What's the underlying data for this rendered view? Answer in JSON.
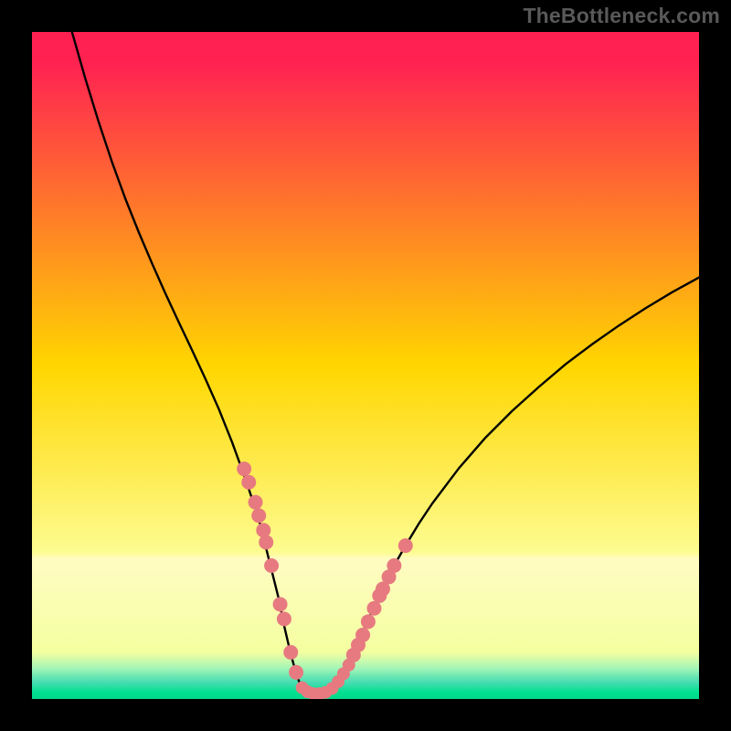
{
  "watermark": "TheBottleneck.com",
  "chart_data": {
    "type": "line",
    "title": "",
    "xlabel": "",
    "ylabel": "",
    "xlim": [
      0,
      100
    ],
    "ylim": [
      0,
      100
    ],
    "gradient_stops": [
      {
        "offset": 0.0,
        "color": "#ff2052"
      },
      {
        "offset": 0.05,
        "color": "#ff2351"
      },
      {
        "offset": 0.5,
        "color": "#ffd600"
      },
      {
        "offset": 0.78,
        "color": "#fdfc90"
      },
      {
        "offset": 0.79,
        "color": "#fffcc2"
      },
      {
        "offset": 0.93,
        "color": "#f4ffa0"
      },
      {
        "offset": 0.955,
        "color": "#a0f5b8"
      },
      {
        "offset": 0.965,
        "color": "#6fe8b3"
      },
      {
        "offset": 0.975,
        "color": "#48dcb2"
      },
      {
        "offset": 0.99,
        "color": "#00e18f"
      },
      {
        "offset": 1.0,
        "color": "#00d68b"
      }
    ],
    "series": [
      {
        "name": "bottleneck-curve",
        "stroke": "#000000",
        "points_xy": [
          [
            6,
            100
          ],
          [
            8,
            93
          ],
          [
            10,
            86.5
          ],
          [
            12,
            80.5
          ],
          [
            14,
            75
          ],
          [
            16,
            70
          ],
          [
            18,
            65.3
          ],
          [
            20,
            60.8
          ],
          [
            22,
            56.5
          ],
          [
            24,
            52.3
          ],
          [
            26,
            48
          ],
          [
            28,
            43.5
          ],
          [
            30,
            38.5
          ],
          [
            32,
            33
          ],
          [
            34,
            27
          ],
          [
            35,
            23
          ],
          [
            36,
            19
          ],
          [
            37,
            15
          ],
          [
            37.8,
            11
          ],
          [
            38.5,
            8
          ],
          [
            39,
            6
          ],
          [
            39.7,
            3.5
          ],
          [
            40.3,
            2
          ],
          [
            41,
            1
          ],
          [
            42,
            0.5
          ],
          [
            43,
            0.4
          ],
          [
            44,
            0.6
          ],
          [
            45,
            1.3
          ],
          [
            46,
            2.5
          ],
          [
            47,
            4.2
          ],
          [
            48,
            6.3
          ],
          [
            49,
            8.7
          ],
          [
            50,
            11
          ],
          [
            52,
            15.5
          ],
          [
            54,
            19.5
          ],
          [
            56,
            23
          ],
          [
            58,
            26.3
          ],
          [
            60,
            29.3
          ],
          [
            64,
            34.6
          ],
          [
            68,
            39.2
          ],
          [
            72,
            43.2
          ],
          [
            76,
            46.8
          ],
          [
            80,
            50.2
          ],
          [
            84,
            53.2
          ],
          [
            88,
            56
          ],
          [
            92,
            58.6
          ],
          [
            96,
            61
          ],
          [
            100,
            63.2
          ]
        ]
      },
      {
        "name": "data-markers-left",
        "marker_color": "#e77a80",
        "marker_r": 8,
        "points_xy": [
          [
            31.8,
            34.5
          ],
          [
            32.5,
            32.5
          ],
          [
            33.5,
            29.5
          ],
          [
            34,
            27.5
          ],
          [
            34.7,
            25.3
          ],
          [
            35.1,
            23.5
          ],
          [
            35.9,
            20
          ],
          [
            37.2,
            14.2
          ],
          [
            37.8,
            12
          ],
          [
            38.8,
            7
          ],
          [
            39.6,
            4
          ]
        ]
      },
      {
        "name": "data-markers-bottom",
        "marker_color": "#e77a80",
        "marker_r": 7,
        "points_xy": [
          [
            40.5,
            1.7
          ],
          [
            41.3,
            1.1
          ],
          [
            42.2,
            0.8
          ],
          [
            43.1,
            0.8
          ],
          [
            44,
            1
          ],
          [
            45,
            1.6
          ],
          [
            45.9,
            2.6
          ],
          [
            46.7,
            3.8
          ],
          [
            47.5,
            5.1
          ]
        ]
      },
      {
        "name": "data-markers-right",
        "marker_color": "#e77a80",
        "marker_r": 8,
        "points_xy": [
          [
            48.2,
            6.6
          ],
          [
            48.9,
            8.1
          ],
          [
            49.6,
            9.6
          ],
          [
            50.4,
            11.6
          ],
          [
            51.3,
            13.6
          ],
          [
            52.1,
            15.5
          ],
          [
            52.6,
            16.5
          ],
          [
            53.5,
            18.3
          ],
          [
            54.3,
            20
          ],
          [
            56,
            23
          ]
        ]
      }
    ]
  }
}
